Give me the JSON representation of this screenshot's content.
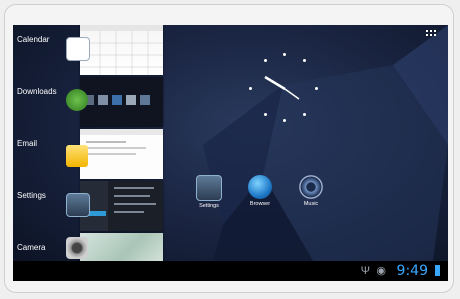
{
  "recents": [
    {
      "label": "Calendar",
      "icon": "calendar-icon"
    },
    {
      "label": "Downloads",
      "icon": "download-icon"
    },
    {
      "label": "Email",
      "icon": "email-icon"
    },
    {
      "label": "Settings",
      "icon": "settings-icon"
    },
    {
      "label": "Camera",
      "icon": "camera-icon"
    }
  ],
  "home_apps": [
    {
      "label": "Settings",
      "icon": "settings-icon"
    },
    {
      "label": "Browser",
      "icon": "globe-icon"
    },
    {
      "label": "Music",
      "icon": "speaker-icon"
    }
  ],
  "status": {
    "time": "9:49"
  },
  "colors": {
    "accent": "#3aa7ff"
  }
}
